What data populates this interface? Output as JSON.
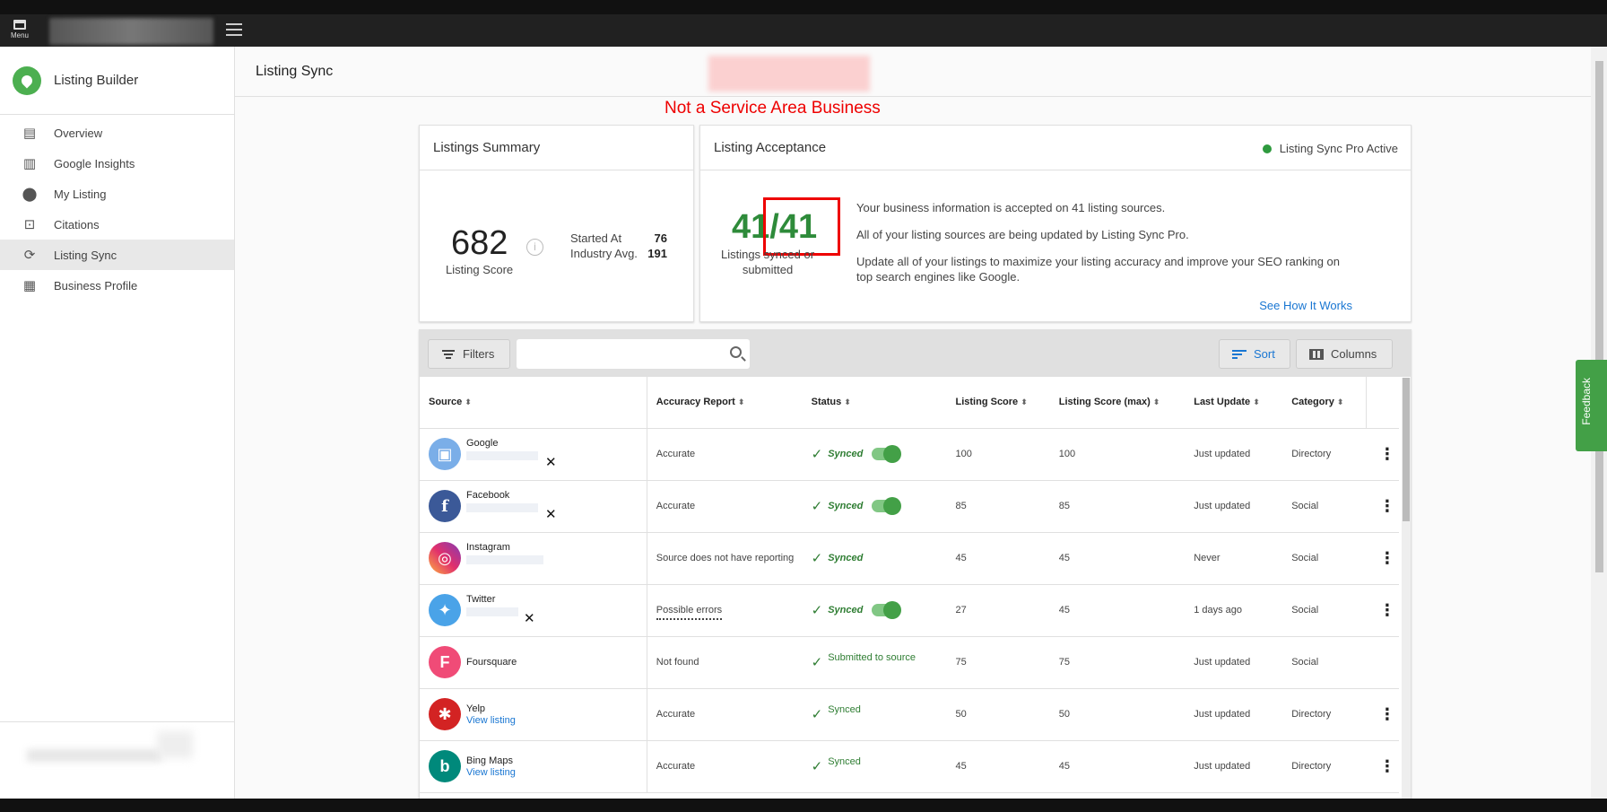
{
  "topbar": {
    "menu_label": "Menu"
  },
  "sidebar": {
    "title": "Listing Builder",
    "items": [
      {
        "label": "Overview",
        "icon": "overview-icon"
      },
      {
        "label": "Google Insights",
        "icon": "bar-chart-icon"
      },
      {
        "label": "My Listing",
        "icon": "map-pin-icon"
      },
      {
        "label": "Citations",
        "icon": "search-box-icon"
      },
      {
        "label": "Listing Sync",
        "icon": "sync-icon",
        "active": true
      },
      {
        "label": "Business Profile",
        "icon": "building-icon"
      }
    ]
  },
  "page": {
    "title": "Listing Sync",
    "annotation": "Not a Service Area Business"
  },
  "summary": {
    "title": "Listings Summary",
    "score": "682",
    "score_label": "Listing Score",
    "started_at_label": "Started At",
    "started_at_value": "76",
    "industry_avg_label": "Industry Avg.",
    "industry_avg_value": "191"
  },
  "acceptance": {
    "title": "Listing Acceptance",
    "status": "Listing Sync Pro Active",
    "ratio": "41/41",
    "ratio_label": "Listings synced or submitted",
    "line1": "Your business information is accepted on 41 listing sources.",
    "line2": "All of your listing sources are being updated by Listing Sync Pro.",
    "line3": "Update all of your listings to maximize your listing accuracy and improve your SEO ranking on top search engines like Google.",
    "link": "See How It Works"
  },
  "toolbar": {
    "filters_label": "Filters",
    "search_placeholder": "",
    "sort_label": "Sort",
    "columns_label": "Columns"
  },
  "table": {
    "headers": {
      "source": "Source",
      "accuracy": "Accuracy Report",
      "status": "Status",
      "score": "Listing Score",
      "score_max": "Listing Score (max)",
      "last_update": "Last Update",
      "category": "Category"
    },
    "rows": [
      {
        "source": "Google",
        "accuracy": "Accurate",
        "status": "Synced",
        "score": "100",
        "score_max": "100",
        "last_update": "Just updated",
        "category": "Directory",
        "logo_color": "#7aaee8",
        "glyph": "▣"
      },
      {
        "source": "Facebook",
        "accuracy": "Accurate",
        "status": "Synced",
        "score": "85",
        "score_max": "85",
        "last_update": "Just updated",
        "category": "Social",
        "logo_color": "#3b5998",
        "glyph": "f"
      },
      {
        "source": "Instagram",
        "accuracy": "Source does not have reporting",
        "status": "Synced",
        "score": "45",
        "score_max": "45",
        "last_update": "Never",
        "category": "Social",
        "logo_color": "#d6249f",
        "glyph": "◎"
      },
      {
        "source": "Twitter",
        "accuracy": "Possible errors",
        "status": "Synced",
        "score": "27",
        "score_max": "45",
        "last_update": "1 days ago",
        "category": "Social",
        "logo_color": "#4aa3e8",
        "glyph": "✦"
      },
      {
        "source": "Foursquare",
        "accuracy": "Not found",
        "status": "Submitted to source",
        "score": "75",
        "score_max": "75",
        "last_update": "Just updated",
        "category": "Social",
        "logo_color": "#f04b77",
        "glyph": "F"
      },
      {
        "source": "Yelp",
        "view": "View listing",
        "accuracy": "Accurate",
        "status": "Synced",
        "score": "50",
        "score_max": "50",
        "last_update": "Just updated",
        "category": "Directory",
        "logo_color": "#d32323",
        "glyph": "✱"
      },
      {
        "source": "Bing Maps",
        "view": "View listing",
        "accuracy": "Accurate",
        "status": "Synced",
        "score": "45",
        "score_max": "45",
        "last_update": "Just updated",
        "category": "Directory",
        "logo_color": "#00897b",
        "glyph": "b"
      }
    ]
  },
  "feedback_label": "Feedback"
}
